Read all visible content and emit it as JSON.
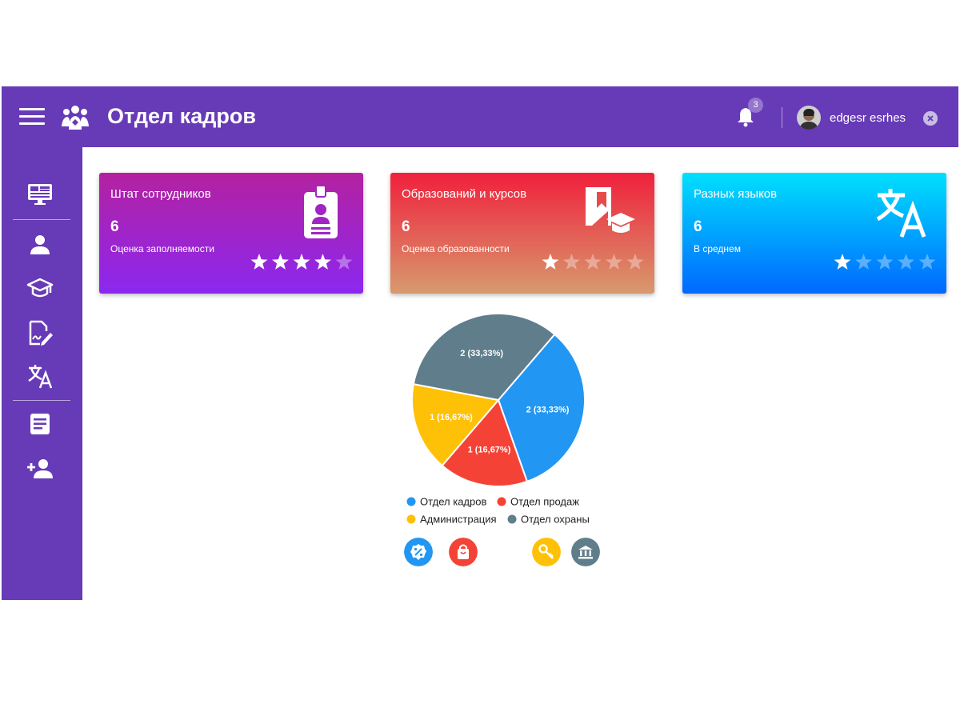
{
  "header": {
    "title": "Отдел кадров",
    "notification_count": "3",
    "user_name": "edgesr esrhes",
    "icons": [
      "menu-icon",
      "people-logo-icon",
      "bell-icon",
      "avatar",
      "close-icon"
    ]
  },
  "sidebar": {
    "items": [
      {
        "icon": "dashboard-icon"
      },
      {
        "icon": "person-icon"
      },
      {
        "icon": "graduation-cap-icon"
      },
      {
        "icon": "document-edit-icon"
      },
      {
        "icon": "translate-icon"
      },
      {
        "icon": "article-icon"
      },
      {
        "icon": "person-add-icon"
      }
    ]
  },
  "cards": [
    {
      "title": "Штат сотрудников",
      "value": "6",
      "subtitle": "Оценка заполняемости",
      "rating": 4,
      "max_rating": 5,
      "icon": "badge-icon",
      "colors": [
        "#b421a0",
        "#8b28f0"
      ]
    },
    {
      "title": "Образований и курсов",
      "value": "6",
      "subtitle": "Оценка образованности",
      "rating": 1,
      "max_rating": 5,
      "icon": "education-book-icon",
      "colors": [
        "#f0203c",
        "#d79a6e"
      ]
    },
    {
      "title": "Разных языков",
      "value": "6",
      "subtitle": "В среднем",
      "rating": 1,
      "max_rating": 5,
      "icon": "translate-icon",
      "colors": [
        "#00e0fd",
        "#0068ff"
      ]
    }
  ],
  "chart_data": {
    "type": "pie",
    "title": "",
    "slices": [
      {
        "name": "Отдел кадров",
        "value": 2,
        "label": "2 (33,33%)",
        "color": "#2196f3"
      },
      {
        "name": "Отдел продаж",
        "value": 1,
        "label": "1 (16,67%)",
        "color": "#f44336"
      },
      {
        "name": "Администрация",
        "value": 1,
        "label": "1 (16,67%)",
        "color": "#ffc107"
      },
      {
        "name": "Отдел охраны",
        "value": 2,
        "label": "2 (33,33%)",
        "color": "#607d8b"
      }
    ],
    "legend_position": "bottom"
  },
  "department_buttons": [
    {
      "icon": "discount-icon",
      "color": "#2196f3"
    },
    {
      "icon": "shopping-bag-icon",
      "color": "#f44336"
    },
    {
      "icon": "key-icon",
      "color": "#ffc107"
    },
    {
      "icon": "bank-icon",
      "color": "#607d8b"
    }
  ],
  "colors": {
    "primary": "#673ab7",
    "accent": "#9575cd"
  }
}
